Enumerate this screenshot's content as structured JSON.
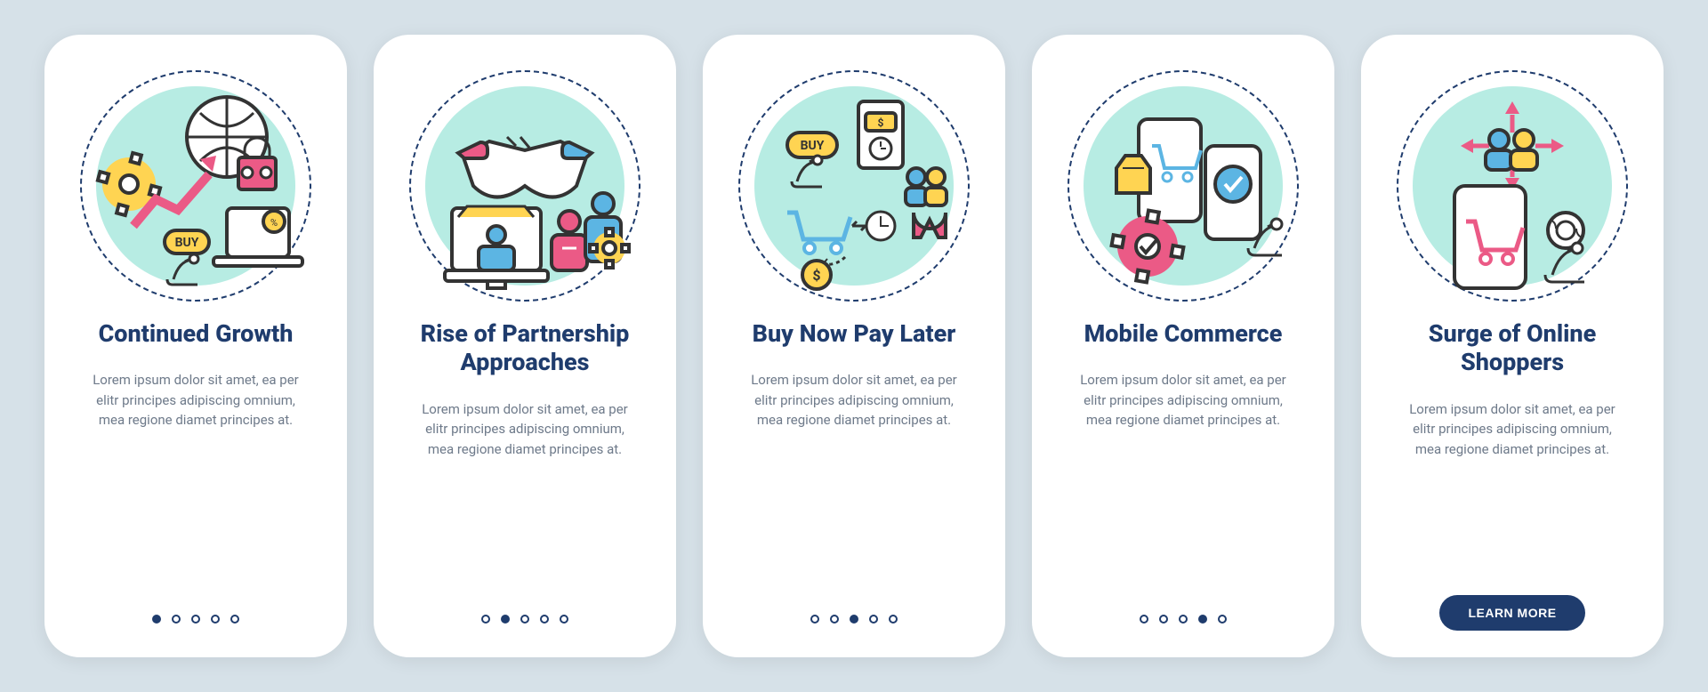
{
  "colors": {
    "navy": "#1f3c6d",
    "pink": "#eb5a86",
    "mint": "#b7ece3",
    "yellow": "#ffd452",
    "blue": "#5cb5e3",
    "stroke": "#333333"
  },
  "shared": {
    "desc": "Lorem ipsum dolor sit amet, ea per elitr principes adipiscing omnium, mea regione diamet principes at.",
    "total_slides": 5,
    "button_label": "LEARN MORE"
  },
  "cards": [
    {
      "title": "Continued Growth",
      "active_index": 0,
      "icon": "growth-icon",
      "show_button": false
    },
    {
      "title": "Rise of Partnership Approaches",
      "active_index": 1,
      "icon": "partnership-icon",
      "show_button": false
    },
    {
      "title": "Buy Now Pay Later",
      "active_index": 2,
      "icon": "buy-now-pay-later-icon",
      "show_button": false
    },
    {
      "title": "Mobile Commerce",
      "active_index": 3,
      "icon": "mobile-commerce-icon",
      "show_button": false
    },
    {
      "title": "Surge of Online Shoppers",
      "active_index": 4,
      "icon": "online-shoppers-icon",
      "show_button": true
    }
  ]
}
